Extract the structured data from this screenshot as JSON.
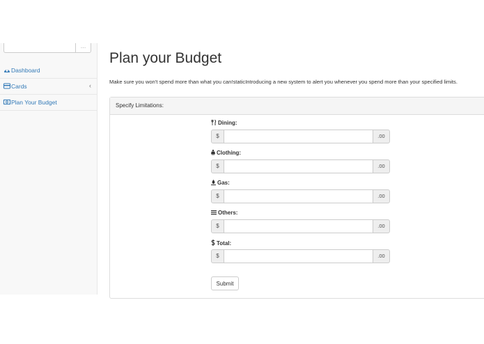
{
  "sidebar": {
    "search": {
      "button_icon": "ellipsis-icon",
      "button_text": "…"
    },
    "items": [
      {
        "label": "Dashboard",
        "icon": "dashboard-icon"
      },
      {
        "label": "Cards",
        "icon": "credit-card-icon",
        "chevron": "‹"
      },
      {
        "label": "Plan Your Budget",
        "icon": "money-icon"
      }
    ]
  },
  "page": {
    "title": "Plan your Budget",
    "description": "Make sure you won't spend more than what you can!staticIntroducing a new system to alert you whenever you spend more than your specified limits."
  },
  "panel": {
    "heading": "Specify Limitations:",
    "fields": [
      {
        "label": "Dining:",
        "icon": "cutlery-icon",
        "prefix": "$",
        "suffix": ".00",
        "value": ""
      },
      {
        "label": "Clothing:",
        "icon": "person-icon",
        "prefix": "$",
        "suffix": ".00",
        "value": ""
      },
      {
        "label": "Gas:",
        "icon": "gas-icon",
        "prefix": "$",
        "suffix": ".00",
        "value": ""
      },
      {
        "label": "Others:",
        "icon": "list-icon",
        "prefix": "$",
        "suffix": ".00",
        "value": ""
      },
      {
        "label": "Total:",
        "icon": "dollar-icon",
        "prefix": "$",
        "suffix": ".00",
        "value": ""
      }
    ],
    "submit_label": "Submit"
  },
  "colors": {
    "link": "#337ab7",
    "panel_heading_bg": "#f5f5f5",
    "sidebar_bg": "#f8f8f8"
  }
}
